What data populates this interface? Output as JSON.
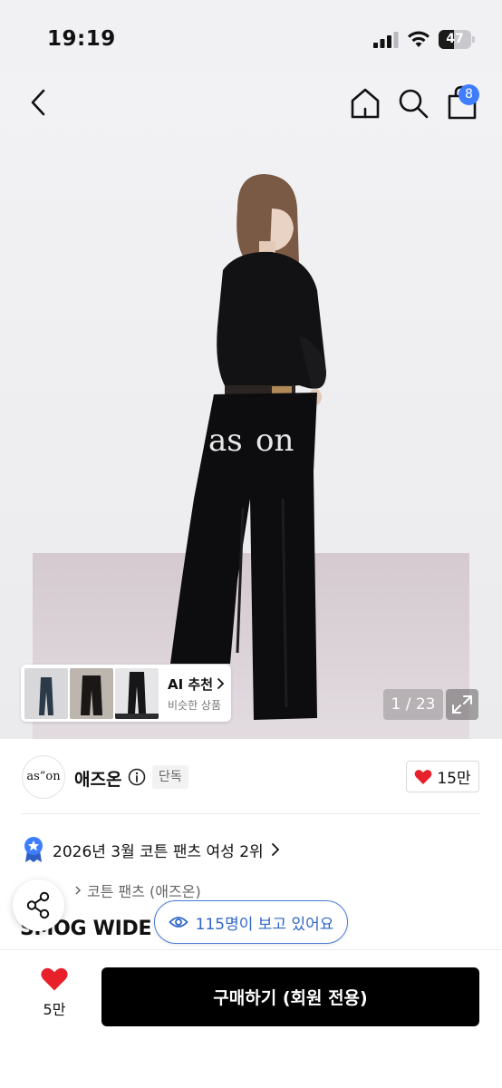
{
  "status_bar": {
    "time": "19:19",
    "battery": "47",
    "battery_level": 0.47
  },
  "header": {
    "cart_count": "8"
  },
  "gallery": {
    "page_counter": "1 / 23",
    "ai_card": {
      "title": "AI 추천",
      "subtitle": "비슷한 상품"
    }
  },
  "brand": {
    "logo_text": "as”on",
    "name": "애즈온",
    "badge": "단독",
    "likes": "15만"
  },
  "product": {
    "ranking": "2026년 3월 코튼 팬츠 여성 2위",
    "breadcrumb": [
      "코튼 팬츠 (애즈온)"
    ],
    "title": "SMOG WIDE"
  },
  "viewers": {
    "text": "115명이 보고 있어요"
  },
  "bottom_bar": {
    "like_count": "5만",
    "buy_label": "구매하기 (회원 전용)"
  },
  "colors": {
    "accent_blue": "#3f7dff",
    "heart_red": "#e8202a",
    "buy_button": "#000000"
  }
}
